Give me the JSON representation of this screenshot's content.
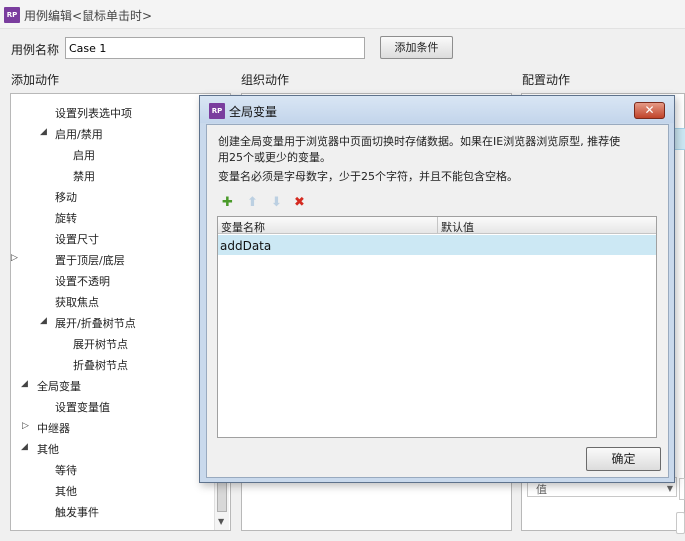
{
  "window": {
    "title": "用例编辑<鼠标单击时>",
    "logo": "RP"
  },
  "case": {
    "label": "用例名称",
    "value": "Case 1",
    "add_condition_label": "添加条件"
  },
  "columns": {
    "add_action": "添加动作",
    "organize_action": "组织动作",
    "configure_action": "配置动作"
  },
  "tree": [
    {
      "label": "设置列表选中项",
      "expander": ""
    },
    {
      "label": "启用/禁用",
      "expander": "◢"
    },
    {
      "label": "启用",
      "expander": ""
    },
    {
      "label": "禁用",
      "expander": ""
    },
    {
      "label": "移动",
      "expander": ""
    },
    {
      "label": "旋转",
      "expander": ""
    },
    {
      "label": "设置尺寸",
      "expander": ""
    },
    {
      "label": "置于顶层/底层",
      "expander": "▷"
    },
    {
      "label": "设置不透明",
      "expander": ""
    },
    {
      "label": "获取焦点",
      "expander": ""
    },
    {
      "label": "展开/折叠树节点",
      "expander": "◢"
    },
    {
      "label": "展开树节点",
      "expander": ""
    },
    {
      "label": "折叠树节点",
      "expander": ""
    },
    {
      "label": "全局变量",
      "expander": "◢"
    },
    {
      "label": "设置变量值",
      "expander": ""
    },
    {
      "label": "中继器",
      "expander": "▷"
    },
    {
      "label": "其他",
      "expander": "◢"
    },
    {
      "label": "等待",
      "expander": ""
    },
    {
      "label": "其他",
      "expander": ""
    },
    {
      "label": "触发事件",
      "expander": ""
    }
  ],
  "right": {
    "select_value": "值"
  },
  "dialog": {
    "logo": "RP",
    "title": "全局变量",
    "close_label": "✕",
    "desc_line1": "创建全局变量用于浏览器中页面切换时存储数据。如果在IE浏览器浏览原型, 推荐使",
    "desc_line2": "用25个或更少的变量。",
    "desc_line3": "变量名必须是字母数字，少于25个字符，并且不能包含空格。",
    "toolbar": {
      "add": "✚",
      "up": "⬆",
      "down": "⬇",
      "delete": "✖"
    },
    "grid": {
      "headers": [
        "变量名称",
        "默认值"
      ],
      "rows": [
        {
          "name": "addData",
          "default": ""
        }
      ]
    },
    "ok_label": "确定"
  }
}
